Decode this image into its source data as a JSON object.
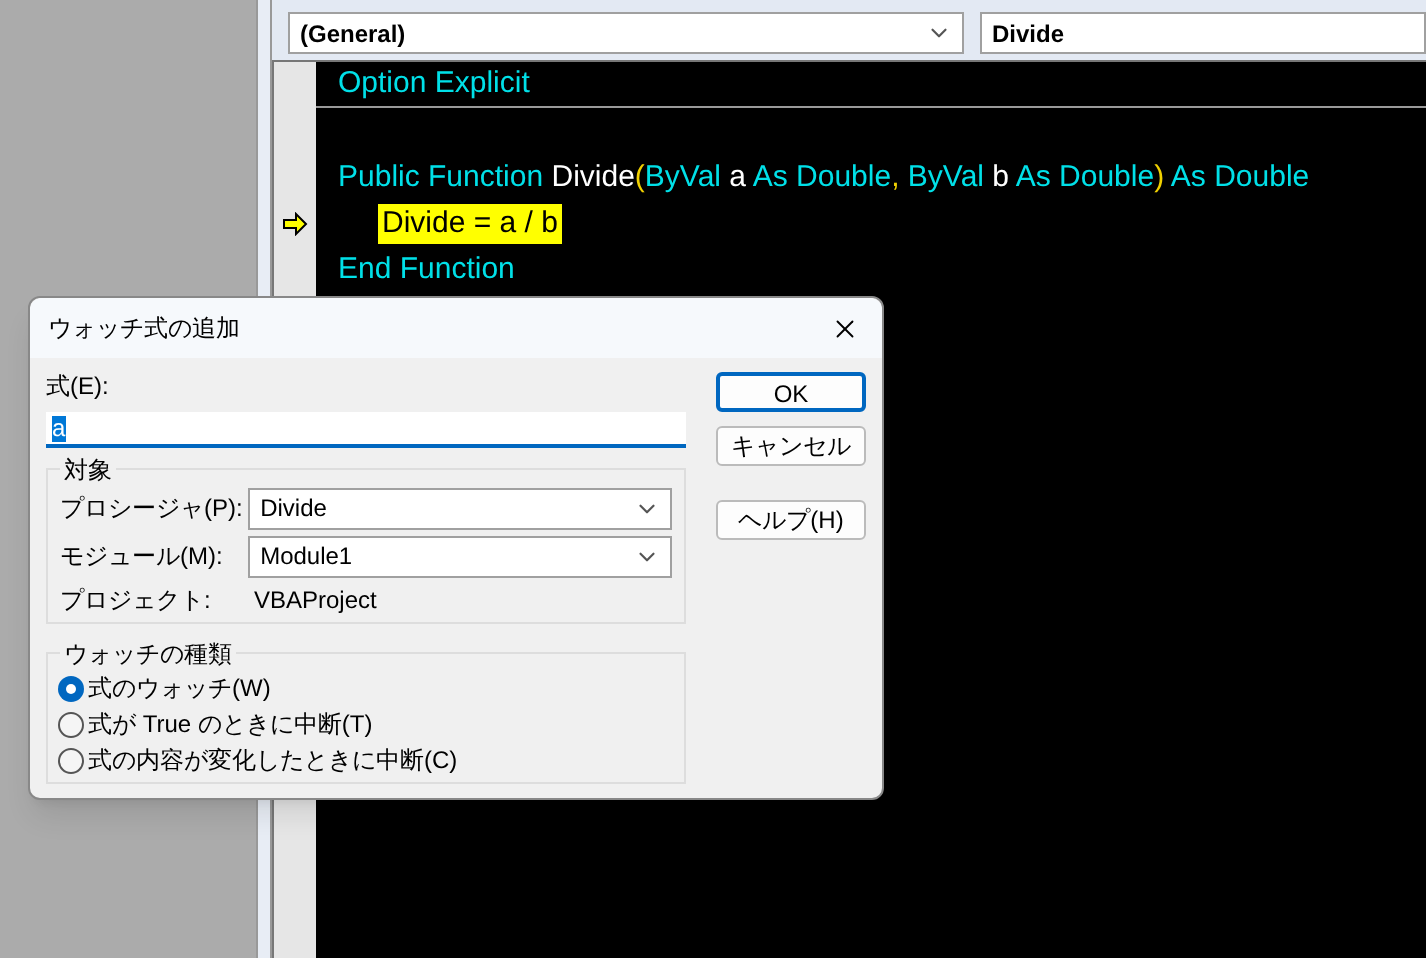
{
  "editor": {
    "object_combo": "(General)",
    "procedure_combo": "Divide",
    "lines": [
      {
        "kind": "code",
        "current": false,
        "separator_after": true,
        "tokens": [
          {
            "text": "Option Explicit",
            "kind": "keyword"
          }
        ]
      },
      {
        "kind": "blank"
      },
      {
        "kind": "code",
        "current": false,
        "separator_after": false,
        "tokens": [
          {
            "text": "Public Function ",
            "kind": "keyword"
          },
          {
            "text": "Divide",
            "kind": "ident"
          },
          {
            "text": "(",
            "kind": "paren"
          },
          {
            "text": "ByVal ",
            "kind": "keyword"
          },
          {
            "text": "a ",
            "kind": "ident"
          },
          {
            "text": "As Double",
            "kind": "keyword"
          },
          {
            "text": ", ",
            "kind": "paren"
          },
          {
            "text": "ByVal ",
            "kind": "keyword"
          },
          {
            "text": "b ",
            "kind": "ident"
          },
          {
            "text": "As Double",
            "kind": "keyword"
          },
          {
            "text": ") ",
            "kind": "paren"
          },
          {
            "text": "As Double",
            "kind": "keyword"
          }
        ]
      },
      {
        "kind": "code",
        "current": true,
        "separator_after": false,
        "tokens": [
          {
            "text": "Divide = a / b",
            "kind": "highlighted"
          }
        ]
      },
      {
        "kind": "code",
        "current": false,
        "separator_after": false,
        "tokens": [
          {
            "text": "End Function",
            "kind": "keyword"
          }
        ]
      }
    ]
  },
  "dialog": {
    "title": "ウォッチ式の追加",
    "expression": {
      "label": "式(E):",
      "value": "a"
    },
    "context": {
      "title": "対象",
      "procedure": {
        "label": "プロシージャ(P):",
        "value": "Divide"
      },
      "module": {
        "label": "モジュール(M):",
        "value": "Module1"
      },
      "project": {
        "label": "プロジェクト:",
        "value": "VBAProject"
      }
    },
    "watch_type": {
      "title": "ウォッチの種類",
      "options": [
        {
          "label": "式のウォッチ(W)",
          "selected": true
        },
        {
          "label": "式が True のときに中断(T)",
          "selected": false
        },
        {
          "label": "式の内容が変化したときに中断(C)",
          "selected": false
        }
      ]
    },
    "buttons": [
      {
        "label": "OK",
        "default": true
      },
      {
        "label": "キャンセル",
        "default": false
      },
      {
        "label": "ヘルプ(H)",
        "default": false
      }
    ]
  }
}
